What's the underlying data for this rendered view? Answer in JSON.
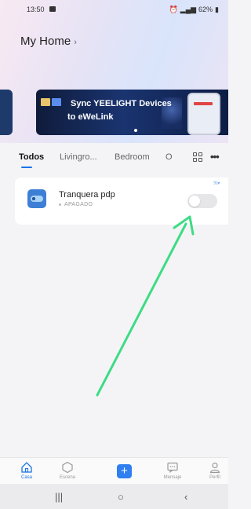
{
  "status_bar": {
    "time": "13:50",
    "battery": "62%"
  },
  "header": {
    "title": "My Home",
    "chevron": "›"
  },
  "banner": {
    "line1": "Sync YEELIGHT Devices",
    "line2": "to eWeLink"
  },
  "tabs": [
    {
      "label": "Todos",
      "active": true
    },
    {
      "label": "Livingro...",
      "active": false
    },
    {
      "label": "Bedroom",
      "active": false
    },
    {
      "label": "O",
      "active": false
    }
  ],
  "device": {
    "name": "Tranquera pdp",
    "status": "APAGADO",
    "state": "off"
  },
  "bottom_nav": [
    {
      "label": "Casa",
      "icon": "home-icon",
      "active": true
    },
    {
      "label": "Escena",
      "icon": "scene-icon",
      "active": false
    },
    {
      "label": "",
      "icon": "add-icon",
      "active": false
    },
    {
      "label": "Mensaje",
      "icon": "message-icon",
      "active": false
    },
    {
      "label": "Perfil",
      "icon": "profile-icon",
      "active": false
    }
  ],
  "colors": {
    "accent": "#1a73e8",
    "arrow": "#3ddc84"
  }
}
